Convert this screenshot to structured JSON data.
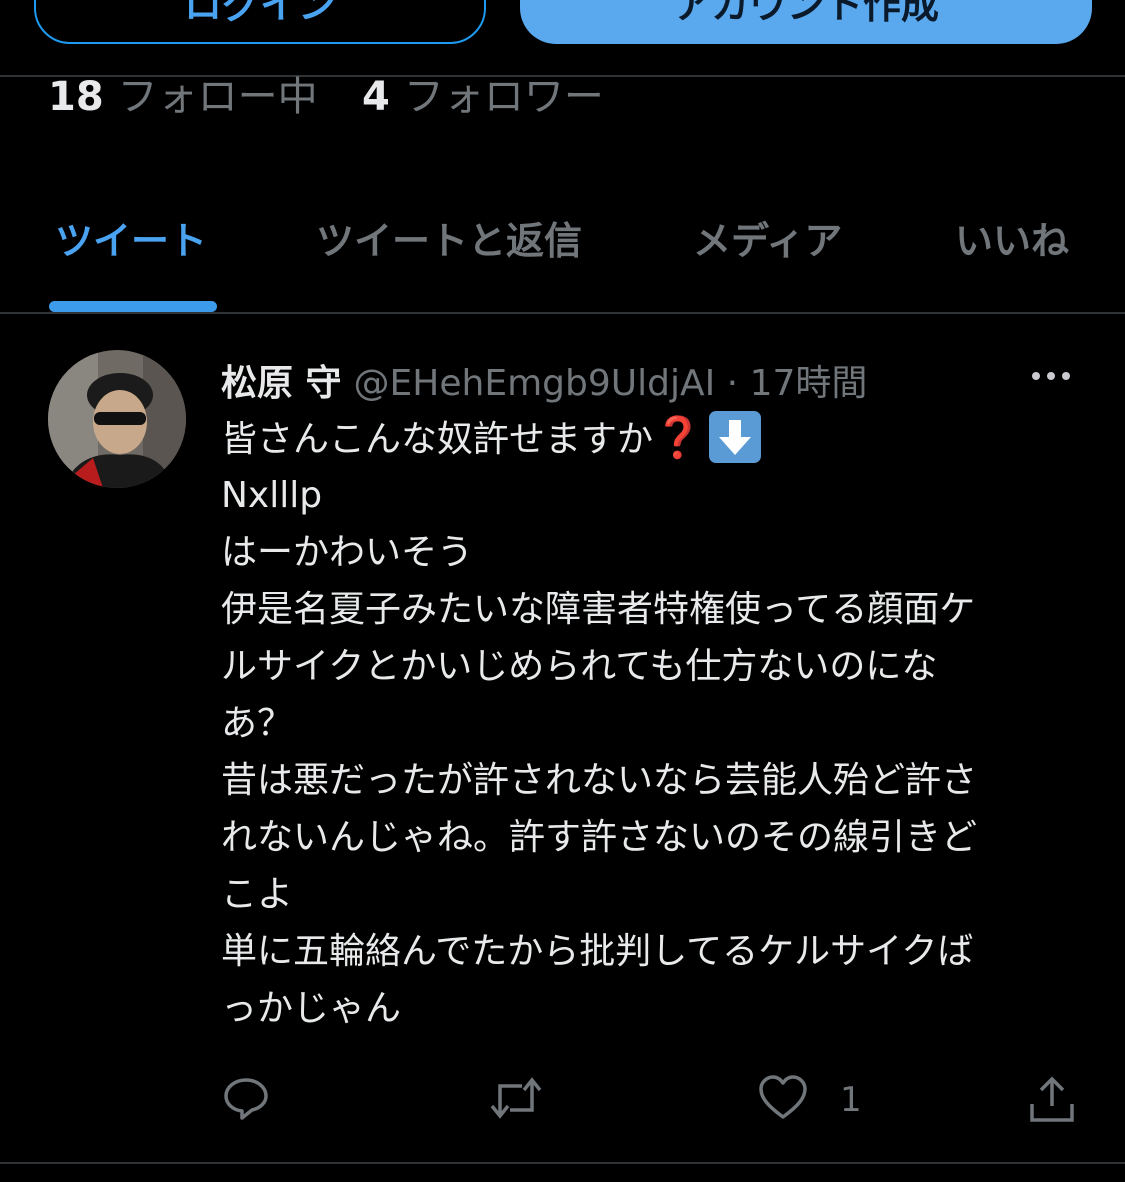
{
  "top_buttons": {
    "login": "ログイン",
    "signup": "アカウント作成"
  },
  "profile_stats": {
    "following_count": "18",
    "following_label": "フォロー中",
    "followers_count": "4",
    "followers_label": "フォロワー"
  },
  "tabs": [
    {
      "label": "ツイート",
      "active": true
    },
    {
      "label": "ツイートと返信",
      "active": false
    },
    {
      "label": "メディア",
      "active": false
    },
    {
      "label": "いいね",
      "active": false
    }
  ],
  "tweet": {
    "display_name": "松原 守",
    "handle": "@EHehEmgb9UldjAI",
    "separator": "·",
    "time": "17時間",
    "lines": [
      "皆さんこんな奴許せますか",
      "Nxlllp",
      "はーかわいそう",
      "伊是名夏子みたいな障害者特権使ってる顔面ケ",
      "ルサイクとかいじめられても仕方ないのにな",
      "あ？",
      "昔は悪だったが許されないなら芸能人殆ど許さ",
      "れないんじゃね。許す許さないのその線引きど",
      "こよ",
      "単に五輪絡んでたから批判してるケルサイクば",
      "っかじゃん"
    ],
    "emoji_1": "❓",
    "like_count": "1"
  },
  "icons": {
    "reply": "reply-icon",
    "retweet": "retweet-icon",
    "like": "heart-icon",
    "share": "share-icon",
    "more": "more-icon",
    "emoji_down": "down-arrow-emoji-icon"
  },
  "colors": {
    "accent": "#1d9bf0",
    "background": "#000000",
    "muted": "#71767b"
  }
}
